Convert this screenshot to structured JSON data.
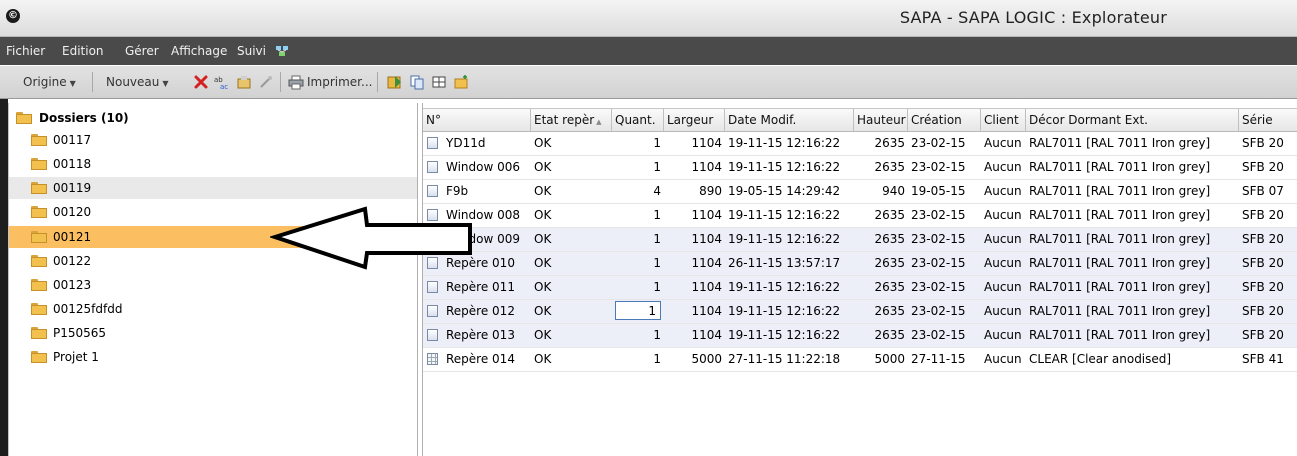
{
  "window": {
    "title": "SAPA - SAPA LOGIC : Explorateur",
    "app_icon": "©"
  },
  "menu": [
    "Fichier",
    "Edition",
    "Gérer",
    "Affichage",
    "Suivi"
  ],
  "toolbar": {
    "origine": "Origine",
    "nouveau": "Nouveau",
    "imprimer": "Imprimer..."
  },
  "tree": {
    "root": "Dossiers (10)",
    "items": [
      "00117",
      "00118",
      "00119",
      "00120",
      "00121",
      "00122",
      "00123",
      "00125fdfdd",
      "P150565",
      "Projet 1"
    ]
  },
  "grid": {
    "columns": [
      "N°",
      "Etat repèr",
      "Quant.",
      "Largeur",
      "Date Modif.",
      "Hauteur",
      "Création",
      "Client",
      "Décor Dormant Ext.",
      "Série"
    ],
    "rows": [
      [
        "YD11d",
        "OK",
        "1",
        "1104",
        "19-11-15 12:16:22",
        "2635",
        "23-02-15",
        "Aucun",
        "RAL7011 [RAL 7011 Iron grey]",
        "SFB 20"
      ],
      [
        "Window 006",
        "OK",
        "1",
        "1104",
        "19-11-15 12:16:22",
        "2635",
        "23-02-15",
        "Aucun",
        "RAL7011 [RAL 7011 Iron grey]",
        "SFB 20"
      ],
      [
        "F9b",
        "OK",
        "4",
        "890",
        "19-05-15 14:29:42",
        "940",
        "19-05-15",
        "Aucun",
        "RAL7011 [RAL 7011 Iron grey]",
        "SFB 07"
      ],
      [
        "Window 008",
        "OK",
        "1",
        "1104",
        "19-11-15 12:16:22",
        "2635",
        "23-02-15",
        "Aucun",
        "RAL7011 [RAL 7011 Iron grey]",
        "SFB 20"
      ],
      [
        "Window 009",
        "OK",
        "1",
        "1104",
        "19-11-15 12:16:22",
        "2635",
        "23-02-15",
        "Aucun",
        "RAL7011 [RAL 7011 Iron grey]",
        "SFB 20"
      ],
      [
        "Repère 010",
        "OK",
        "1",
        "1104",
        "26-11-15 13:57:17",
        "2635",
        "23-02-15",
        "Aucun",
        "RAL7011 [RAL 7011 Iron grey]",
        "SFB 20"
      ],
      [
        "Repère 011",
        "OK",
        "1",
        "1104",
        "19-11-15 12:16:22",
        "2635",
        "23-02-15",
        "Aucun",
        "RAL7011 [RAL 7011 Iron grey]",
        "SFB 20"
      ],
      [
        "Repère 012",
        "OK",
        "1",
        "1104",
        "19-11-15 12:16:22",
        "2635",
        "23-02-15",
        "Aucun",
        "RAL7011 [RAL 7011 Iron grey]",
        "SFB 20"
      ],
      [
        "Repère 013",
        "OK",
        "1",
        "1104",
        "19-11-15 12:16:22",
        "2635",
        "23-02-15",
        "Aucun",
        "RAL7011 [RAL 7011 Iron grey]",
        "SFB 20"
      ],
      [
        "Repère 014",
        "OK",
        "1",
        "5000",
        "27-11-15 11:22:18",
        "5000",
        "27-11-15",
        "Aucun",
        "CLEAR [Clear anodised]",
        "SFB 41"
      ]
    ]
  }
}
